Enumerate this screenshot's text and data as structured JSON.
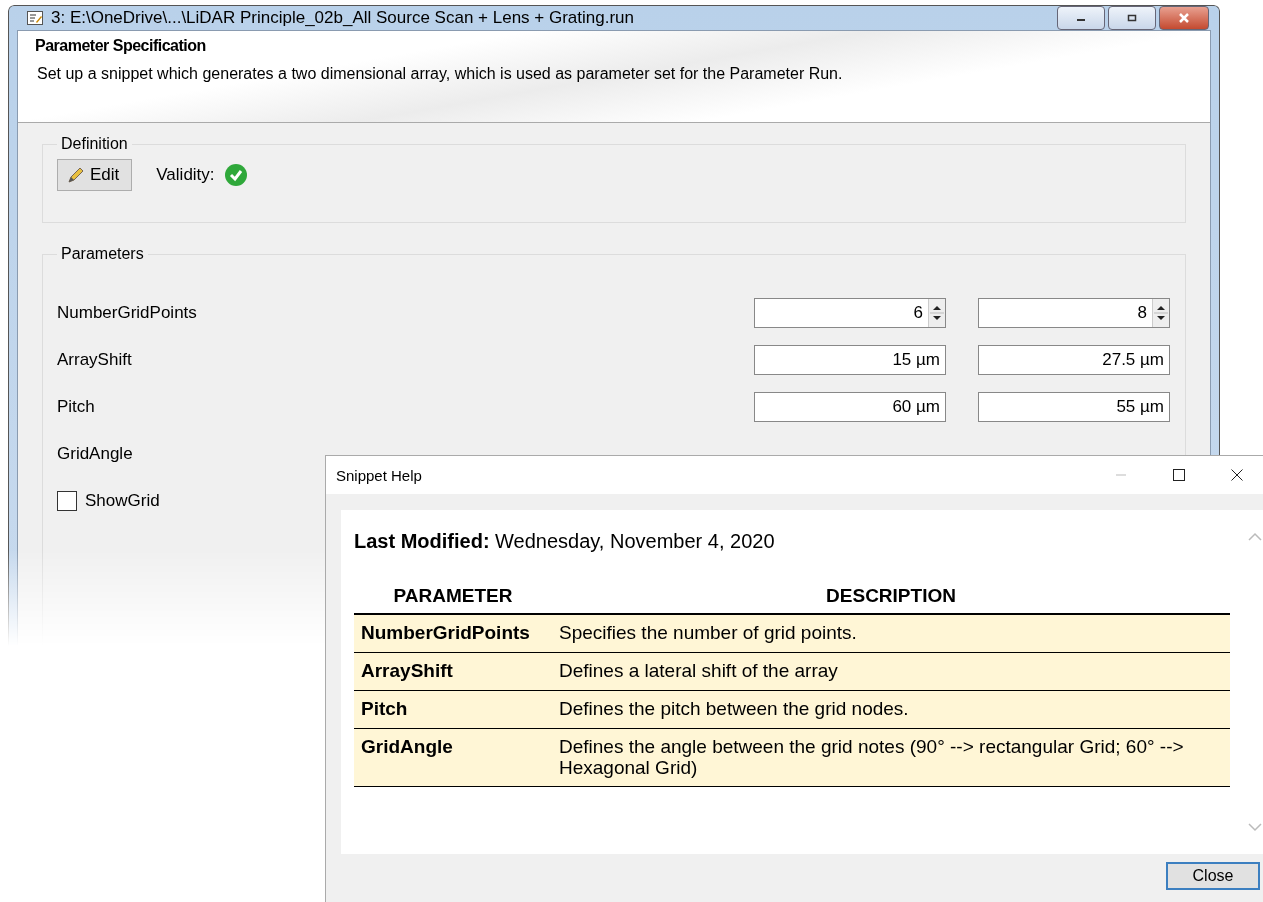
{
  "main_window": {
    "title": "3: E:\\OneDrive\\...\\LiDAR Principle_02b_All Source Scan + Lens + Grating.run",
    "header": {
      "title": "Parameter Specification",
      "description": "Set up a snippet which generates a two dimensional array, which is used as parameter set for the Parameter Run."
    },
    "definition": {
      "label": "Definition",
      "edit_button": "Edit",
      "validity_label": "Validity:",
      "valid": true
    },
    "parameters": {
      "label": "Parameters",
      "rows": [
        {
          "kind": "spinner",
          "name": "NumberGridPoints",
          "values": [
            "6",
            "8"
          ]
        },
        {
          "kind": "text",
          "name": "ArrayShift",
          "values": [
            "15 µm",
            "27.5 µm"
          ]
        },
        {
          "kind": "text",
          "name": "Pitch",
          "values": [
            "60 µm",
            "55 µm"
          ]
        },
        {
          "kind": "label",
          "name": "GridAngle"
        },
        {
          "kind": "checkbox",
          "name": "ShowGrid",
          "checked": false
        }
      ]
    }
  },
  "help_dialog": {
    "title": "Snippet Help",
    "last_modified_label": "Last Modified:",
    "last_modified": "Wednesday, November 4, 2020",
    "table": {
      "columns": [
        "PARAMETER",
        "DESCRIPTION"
      ],
      "rows": [
        [
          "NumberGridPoints",
          "Specifies the number of grid points."
        ],
        [
          "ArrayShift",
          "Defines a lateral shift of the array"
        ],
        [
          "Pitch",
          "Defines the pitch between the grid nodes."
        ],
        [
          "GridAngle",
          "Defines the angle between the grid notes (90° --> rectangular Grid; 60° --> Hexagonal Grid)"
        ]
      ]
    },
    "close_button": "Close"
  }
}
